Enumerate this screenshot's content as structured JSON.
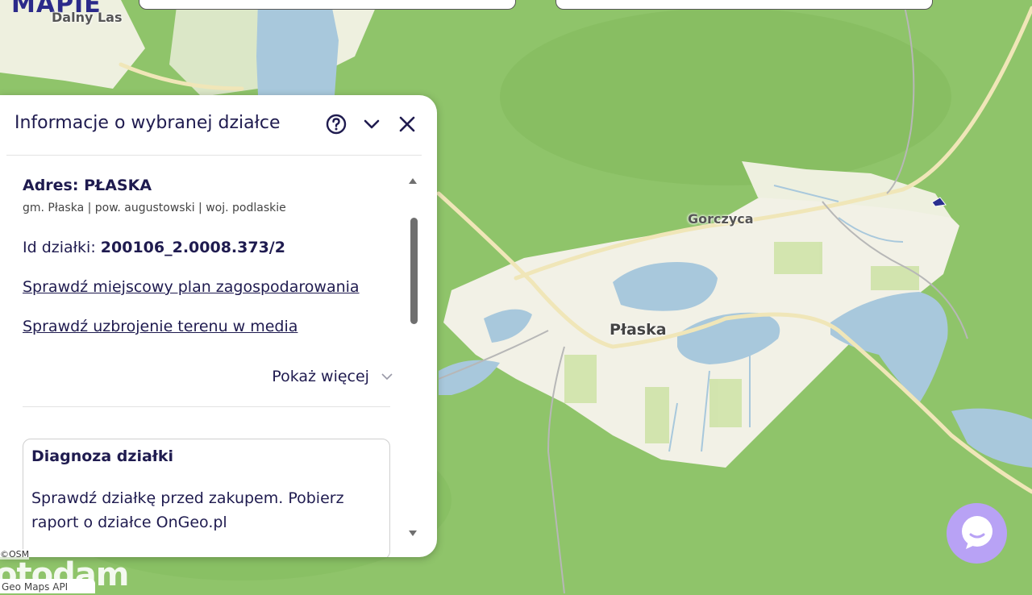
{
  "map": {
    "brand": "MAPIE",
    "labels": {
      "dalny_las": "Dalny Las",
      "gorczyca": "Gorczyca",
      "plaska": "Płaska"
    },
    "watermark": "otodam",
    "attr_small": "©OSM",
    "geo_attr": "Geo Maps API",
    "colors": {
      "forest": "#8fc46a",
      "urban": "#f2f1e6",
      "water": "#a8c8dc"
    }
  },
  "panel": {
    "title": "Informacje o wybranej działce",
    "icons": {
      "help": "help-icon",
      "collapse": "chevron-down-icon",
      "close": "close-icon"
    },
    "address_label": "Adres: PŁASKA",
    "subline": "gm. Płaska | pow. augustowski | woj. podlaskie",
    "id_label": "Id działki: ",
    "id_value": "200106_2.0008.373/2",
    "link_plan": "Sprawdź miejscowy plan zagospodarowania",
    "link_media": "Sprawdź uzbrojenie terenu w media",
    "show_more": "Pokaż więcej",
    "diagnosis_title": "Diagnoza działki",
    "diagnosis_text": "Sprawdź działkę przed zakupem. Pobierz raport o działce OnGeo.pl"
  },
  "chat": {
    "icon": "chat-icon",
    "color": "#b8a2f5"
  }
}
